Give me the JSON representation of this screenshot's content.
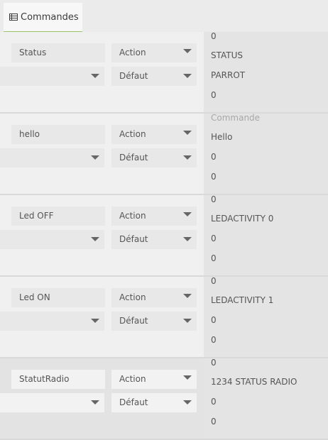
{
  "tab": {
    "label": "Commandes",
    "icon": "list-icon"
  },
  "rows": [
    {
      "name": "Status",
      "subtype_value": "",
      "type": "Action",
      "subtype": "Défaut",
      "right": {
        "l1": "0",
        "l2": "STATUS",
        "l3": "PARROT",
        "l4": "0",
        "l1_placeholder": ""
      }
    },
    {
      "name": "hello",
      "subtype_value": "",
      "type": "Action",
      "subtype": "Défaut",
      "right": {
        "l1": "",
        "l1_placeholder": "Commande",
        "l2": "Hello",
        "l3": "0",
        "l4": "0"
      }
    },
    {
      "name": "Led OFF",
      "subtype_value": "",
      "type": "Action",
      "subtype": "Défaut",
      "right": {
        "l1": "0",
        "l2": "LEDACTIVITY 0",
        "l3": "0",
        "l4": "0",
        "l1_placeholder": ""
      }
    },
    {
      "name": "Led ON",
      "subtype_value": "",
      "type": "Action",
      "subtype": "Défaut",
      "right": {
        "l1": "0",
        "l2": "LEDACTIVITY 1",
        "l3": "0",
        "l4": "0",
        "l1_placeholder": ""
      }
    },
    {
      "name": "StatutRadio",
      "subtype_value": "",
      "type": "Action",
      "subtype": "Défaut",
      "right": {
        "l1": "0",
        "l2": "1234 STATUS RADIO",
        "l3": "0",
        "l4": "0",
        "l1_placeholder": ""
      }
    }
  ]
}
